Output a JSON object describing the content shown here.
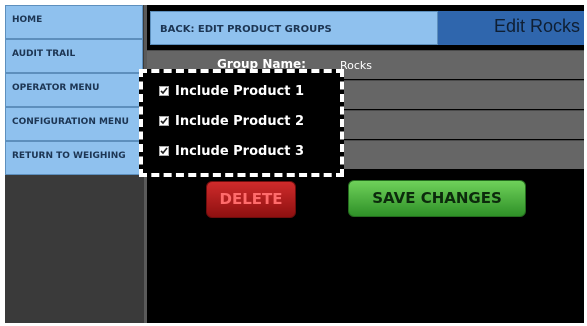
{
  "sidebar": {
    "items": [
      {
        "label": "HOME"
      },
      {
        "label": "AUDIT TRAIL"
      },
      {
        "label": "OPERATOR MENU"
      },
      {
        "label": "CONFIGURATION MENU"
      },
      {
        "label": "RETURN TO WEIGHING"
      }
    ]
  },
  "header": {
    "back_label": "BACK: EDIT PRODUCT GROUPS",
    "title": "Edit Rocks"
  },
  "form": {
    "group_name_label": "Group Name:",
    "group_name_value": "Rocks",
    "checkboxes": [
      {
        "label": "Include Product 1",
        "checked": true
      },
      {
        "label": "Include Product 2",
        "checked": true
      },
      {
        "label": "Include Product 3",
        "checked": true
      }
    ]
  },
  "actions": {
    "delete_label": "DELETE",
    "save_label": "SAVE CHANGES"
  },
  "colors": {
    "nav_button": "#8fc1ee",
    "title_bar": "#2f66ad",
    "delete": "#b81c1c",
    "save": "#4cbc3c"
  }
}
